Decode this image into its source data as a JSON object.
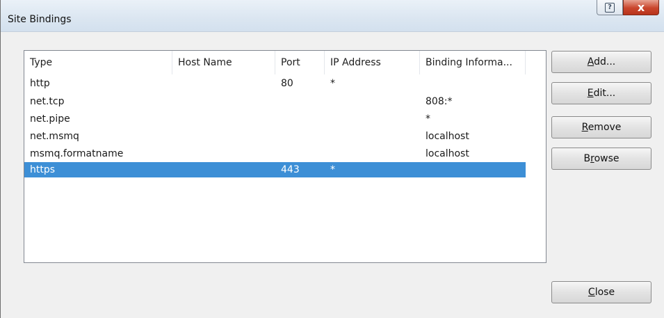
{
  "window": {
    "title": "Site Bindings"
  },
  "titlebar_buttons": {
    "help_icon": "question-icon",
    "close_icon": "close-x-icon",
    "help_glyph": "?",
    "close_glyph": "x"
  },
  "bindings_table": {
    "columns": [
      "Type",
      "Host Name",
      "Port",
      "IP Address",
      "Binding Informa..."
    ],
    "rows": [
      {
        "type": "http",
        "host_name": "",
        "port": "80",
        "ip_address": "*",
        "binding_info": ""
      },
      {
        "type": "net.tcp",
        "host_name": "",
        "port": "",
        "ip_address": "",
        "binding_info": "808:*"
      },
      {
        "type": "net.pipe",
        "host_name": "",
        "port": "",
        "ip_address": "",
        "binding_info": "*"
      },
      {
        "type": "net.msmq",
        "host_name": "",
        "port": "",
        "ip_address": "",
        "binding_info": "localhost"
      },
      {
        "type": "msmq.formatname",
        "host_name": "",
        "port": "",
        "ip_address": "",
        "binding_info": "localhost"
      },
      {
        "type": "https",
        "host_name": "",
        "port": "443",
        "ip_address": "*",
        "binding_info": ""
      }
    ],
    "selected_row": "https",
    "selection_color": "#3d8fd6"
  },
  "buttons": {
    "add": {
      "mnemonic": "A",
      "rest": "dd..."
    },
    "edit": {
      "mnemonic": "E",
      "rest": "dit..."
    },
    "remove": {
      "mnemonic": "R",
      "rest": "emove"
    },
    "browse_pre": "B",
    "browse_mnemonic": "r",
    "browse_rest": "owse",
    "close": {
      "mnemonic": "C",
      "rest": "lose"
    }
  }
}
